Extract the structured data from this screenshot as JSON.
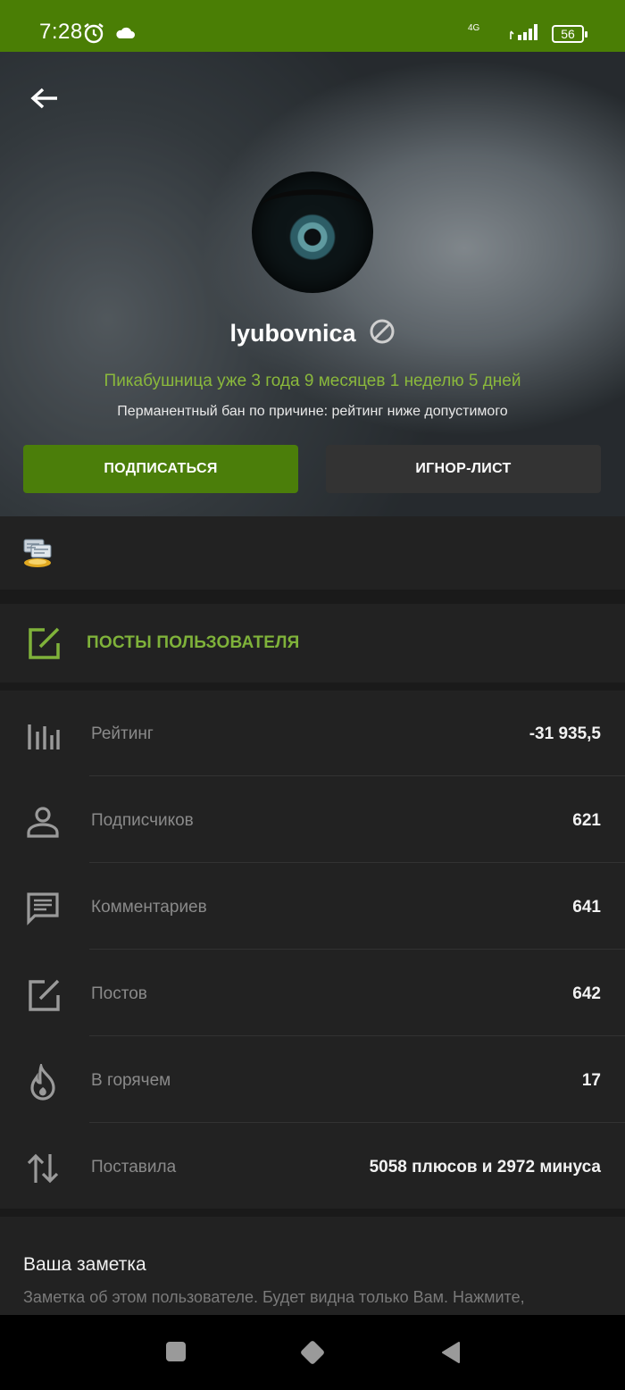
{
  "status_bar": {
    "time": "7:28",
    "network": "4G",
    "battery": "56"
  },
  "profile": {
    "username": "lyubovnica",
    "member_since": "Пикабушница уже 3 года 9 месяцев 1 неделю 5 дней",
    "ban_reason": "Перманентный бан по причине: рейтинг ниже допустимого",
    "subscribe_label": "ПОДПИСАТЬСЯ",
    "ignore_label": "ИГНОР-ЛИСТ"
  },
  "posts_link": {
    "label": "ПОСТЫ ПОЛЬЗОВАТЕЛЯ"
  },
  "stats": [
    {
      "icon": "bar-chart-icon",
      "label": "Рейтинг",
      "value": "-31 935,5"
    },
    {
      "icon": "person-icon",
      "label": "Подписчиков",
      "value": "621"
    },
    {
      "icon": "comment-icon",
      "label": "Комментариев",
      "value": "641"
    },
    {
      "icon": "edit-icon",
      "label": "Постов",
      "value": "642"
    },
    {
      "icon": "flame-icon",
      "label": "В горячем",
      "value": "17"
    },
    {
      "icon": "swap-vertical-icon",
      "label": "Поставила",
      "value": "5058 плюсов и 2972 минуса"
    }
  ],
  "note": {
    "title": "Ваша заметка",
    "hint": "Заметка об этом пользователе. Будет видна только Вам. Нажмите,"
  },
  "colors": {
    "accent_green": "#4b7e0a",
    "link_green": "#7fb23a",
    "since_green": "#8ab83c"
  }
}
